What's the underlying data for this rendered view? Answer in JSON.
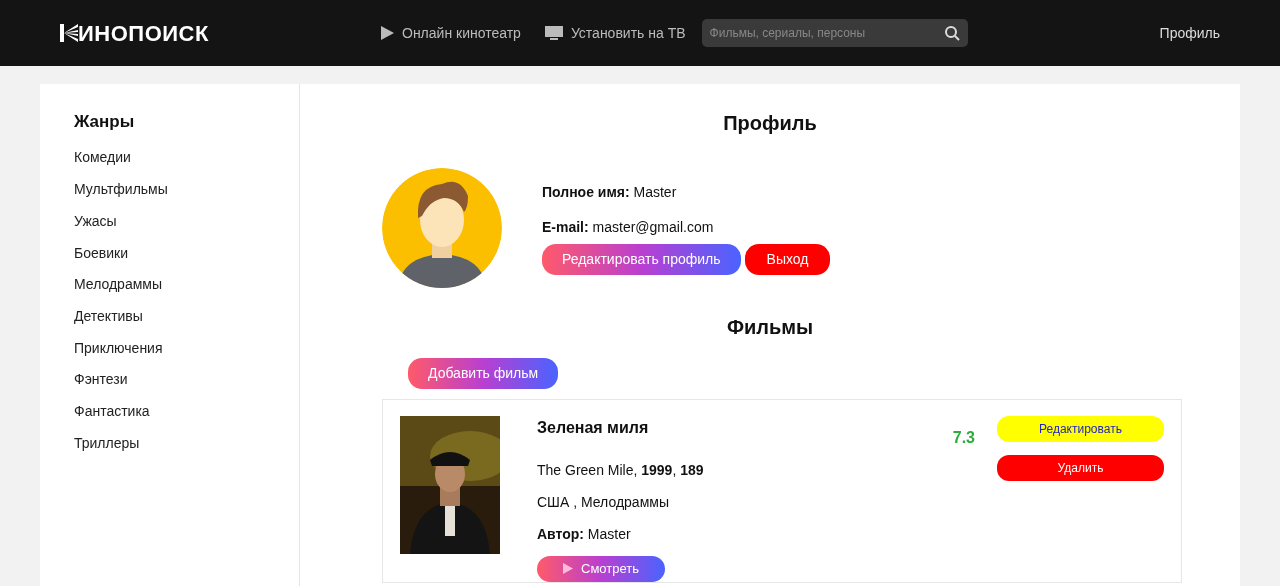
{
  "header": {
    "logo": "ИНОПОИСК",
    "nav": [
      "Онлайн кинотеатр",
      "Установить на ТВ"
    ],
    "search": {
      "placeholder": "Фильмы, сериалы, персоны"
    },
    "profile_link": "Профиль"
  },
  "sidebar": {
    "title": "Жанры",
    "items": [
      "Комедии",
      "Мультфильмы",
      "Ужасы",
      "Боевики",
      "Мелодраммы",
      "Детективы",
      "Приключения",
      "Фэнтези",
      "Фантастика",
      "Триллеры"
    ]
  },
  "profile": {
    "title": "Профиль",
    "fields": [
      {
        "label": "Полное имя:",
        "value": "Master"
      },
      {
        "label": "E-mail:",
        "value": "master@gmail.com"
      }
    ],
    "edit_button": "Редактировать профиль",
    "logout_button": "Выход"
  },
  "films": {
    "title": "Фильмы",
    "add_button": "Добавить фильм",
    "items": [
      {
        "title": "Зеленая миля",
        "details": "The Green Mile, **1999**, **189**",
        "genres": "США , Мелодраммы",
        "author": "**Автор:** Master",
        "watch_button": "Смотреть",
        "rating": "7.3",
        "edit_button": "Редактировать",
        "delete_button": "Удалить"
      }
    ]
  }
}
